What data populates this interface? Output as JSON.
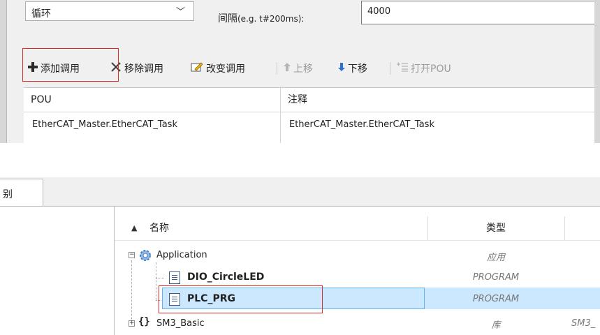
{
  "task_config": {
    "type_value": "循环",
    "interval_label": "间隔",
    "interval_hint": "(e.g. t#200ms):",
    "interval_value": "4000"
  },
  "toolbar": {
    "add_call": "添加调用",
    "remove_call": "移除调用",
    "change_call": "改变调用",
    "move_up": "上移",
    "move_down": "下移",
    "open_pou": "打开POU"
  },
  "pou_table": {
    "headers": [
      "POU",
      "注释"
    ],
    "rows": [
      [
        "EtherCAT_Master.EtherCAT_Task",
        "EtherCAT_Master.EtherCAT_Task"
      ]
    ]
  },
  "tab": {
    "label": "别"
  },
  "tree": {
    "sort_icon": "▲",
    "columns": [
      "名称",
      "类型"
    ],
    "items": [
      {
        "name": "Application",
        "type": "应用",
        "extra": ""
      },
      {
        "name": "DIO_CircleLED",
        "type": "PROGRAM",
        "extra": ""
      },
      {
        "name": "PLC_PRG",
        "type": "PROGRAM",
        "extra": ""
      },
      {
        "name": "SM3_Basic",
        "type": "库",
        "extra": "SM3_"
      }
    ]
  },
  "colors": {
    "highlight": "#e02a2a",
    "selection": "#cce8ff",
    "selection_border": "#66b2e8"
  }
}
